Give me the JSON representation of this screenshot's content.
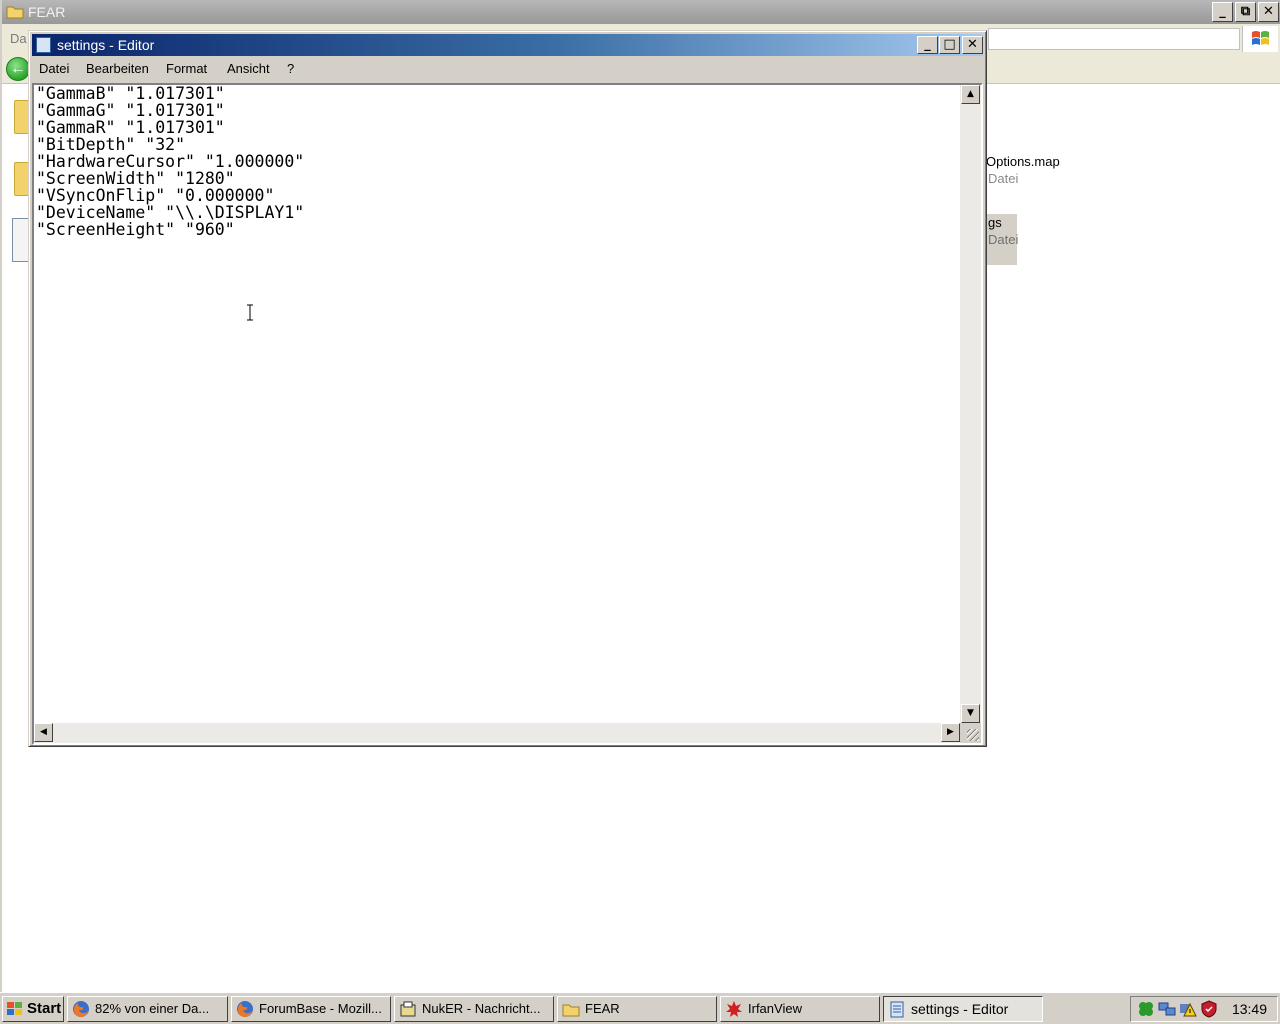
{
  "explorer": {
    "title": "FEAR",
    "menu_first": "Da",
    "files": [
      {
        "name": "Options.map",
        "type": "Datei"
      },
      {
        "name": "gs",
        "type": "Datei"
      }
    ]
  },
  "notepad": {
    "title": "settings - Editor",
    "menu": [
      "Datei",
      "Bearbeiten",
      "Format",
      "Ansicht",
      "?"
    ],
    "lines": [
      "\"GammaB\" \"1.017301\"",
      "\"GammaG\" \"1.017301\"",
      "\"GammaR\" \"1.017301\"",
      "\"BitDepth\" \"32\"",
      "\"HardwareCursor\" \"1.000000\"",
      "\"ScreenWidth\" \"1280\"",
      "\"VSyncOnFlip\" \"0.000000\"",
      "\"DeviceName\" \"\\\\.\\DISPLAY1\"",
      "\"ScreenHeight\" \"960\""
    ]
  },
  "taskbar": {
    "start": "Start",
    "tasks": [
      {
        "label": "82% von einer Da...",
        "icon": "firefox-icon"
      },
      {
        "label": "ForumBase - Mozill...",
        "icon": "firefox-icon"
      },
      {
        "label": "NukER - Nachricht...",
        "icon": "newsreader-icon"
      },
      {
        "label": "FEAR",
        "icon": "folder-icon"
      },
      {
        "label": "IrfanView",
        "icon": "irfanview-icon"
      },
      {
        "label": "settings - Editor",
        "icon": "notepad-icon",
        "active": true
      }
    ],
    "clock": "13:49"
  },
  "colors": {
    "title_active_start": "#0a246a",
    "title_active_end": "#a6caf0",
    "face": "#d4d0c8"
  }
}
